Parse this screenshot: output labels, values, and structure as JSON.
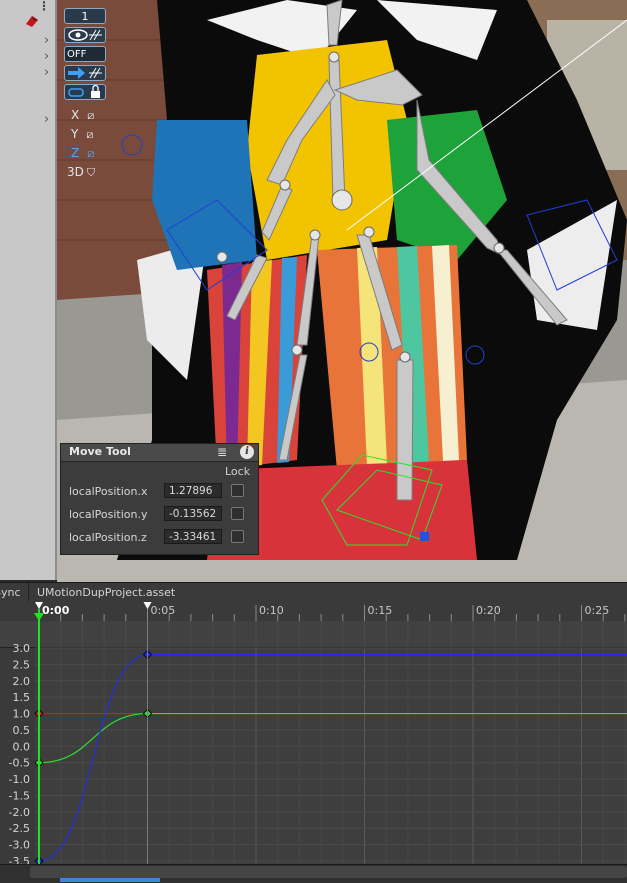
{
  "toolbar": {
    "layer_count": "1",
    "off_label": "OFF",
    "axis_x": "X",
    "axis_y": "Y",
    "axis_z": "Z",
    "mode_3d": "3D"
  },
  "move_tool": {
    "title": "Move Tool",
    "lock_label": "Lock",
    "rows": [
      {
        "label": "localPosition.x",
        "value": "1.27896"
      },
      {
        "label": "localPosition.y",
        "value": "-0.13562"
      },
      {
        "label": "localPosition.z",
        "value": "-3.33461"
      }
    ]
  },
  "animation": {
    "sync_tab": "Sync",
    "asset_tab": "UMotionDupProject.asset",
    "time_labels": [
      "0:00",
      "0:05",
      "0:10",
      "0:15",
      "0:20",
      "0:25"
    ],
    "value_labels": [
      "3.0",
      "2.5",
      "2.0",
      "1.5",
      "1.0",
      "0.5",
      "0.0",
      "-0.5",
      "-1.0",
      "-1.5",
      "-2.0",
      "-2.5",
      "-3.0",
      "-3.5"
    ],
    "curve_colors": {
      "x": "#d02020",
      "y": "#2ee02e",
      "z": "#2030e0"
    },
    "playhead_color": "#22e022",
    "keys": [
      {
        "curve": "x",
        "frame": 0,
        "value": 1.0
      },
      {
        "curve": "x",
        "frame": 5,
        "value": 1.0
      },
      {
        "curve": "y",
        "frame": 0,
        "value": -0.5
      },
      {
        "curve": "y",
        "frame": 5,
        "value": 1.0
      },
      {
        "curve": "z",
        "frame": 0,
        "value": -3.5
      },
      {
        "curve": "z",
        "frame": 5,
        "value": 2.8
      }
    ]
  }
}
